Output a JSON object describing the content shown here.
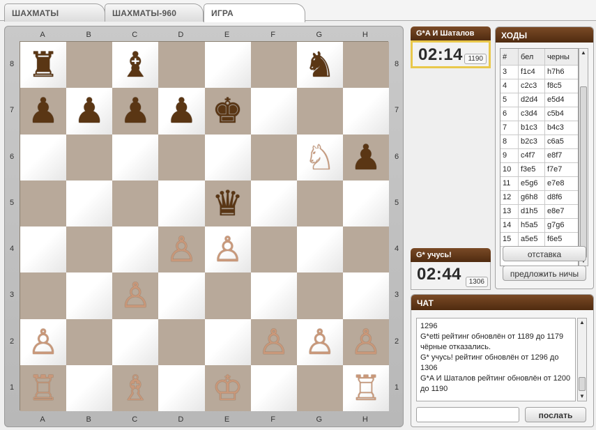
{
  "tabs": [
    {
      "label": "ШАХМАТЫ",
      "active": false
    },
    {
      "label": "ШАХМАТЫ-960",
      "active": false
    },
    {
      "label": "ИГРА",
      "active": true
    }
  ],
  "board": {
    "files": [
      "A",
      "B",
      "C",
      "D",
      "E",
      "F",
      "G",
      "H"
    ],
    "ranks": [
      "8",
      "7",
      "6",
      "5",
      "4",
      "3",
      "2",
      "1"
    ],
    "squares": [
      [
        "♜",
        "",
        "♝",
        "",
        "",
        "",
        "♞",
        ""
      ],
      [
        "♟",
        "♟",
        "♟",
        "♟",
        "♚",
        "",
        "",
        ""
      ],
      [
        "",
        "",
        "",
        "",
        "",
        "",
        "♘",
        "♟"
      ],
      [
        "",
        "",
        "",
        "",
        "♛",
        "",
        "",
        ""
      ],
      [
        "",
        "",
        "",
        "♙",
        "♙",
        "",
        "",
        ""
      ],
      [
        "",
        "",
        "♙",
        "",
        "",
        "",
        "",
        ""
      ],
      [
        "♙",
        "",
        "",
        "",
        "",
        "♙",
        "♙",
        "♙"
      ],
      [
        "♖",
        "",
        "♗",
        "",
        "♔",
        "",
        "",
        "♖"
      ]
    ],
    "colors": [
      "b",
      "w"
    ],
    "pieceColors": [
      [
        "b",
        "",
        "b",
        "",
        "",
        "",
        "b",
        ""
      ],
      [
        "b",
        "b",
        "b",
        "b",
        "b",
        "",
        "",
        ""
      ],
      [
        "",
        "",
        "",
        "",
        "",
        "",
        "w",
        "b"
      ],
      [
        "",
        "",
        "",
        "",
        "b",
        "",
        "",
        ""
      ],
      [
        "",
        "",
        "",
        "w",
        "w",
        "",
        "",
        ""
      ],
      [
        "",
        "",
        "w",
        "",
        "",
        "",
        "",
        ""
      ],
      [
        "w",
        "",
        "",
        "",
        "",
        "w",
        "w",
        "w"
      ],
      [
        "w",
        "",
        "w",
        "",
        "w",
        "",
        "",
        "w"
      ]
    ]
  },
  "clocks": {
    "top": {
      "player": "G*A И Шаталов",
      "time": "02:14",
      "rating": "1190"
    },
    "bottom": {
      "player": "G* учусь!",
      "time": "02:44",
      "rating": "1306"
    }
  },
  "moves": {
    "title": "ХОДЫ",
    "columns": [
      "#",
      "бел",
      "черны"
    ],
    "rows": [
      [
        "3",
        "f1c4",
        "h7h6"
      ],
      [
        "4",
        "c2c3",
        "f8c5"
      ],
      [
        "5",
        "d2d4",
        "e5d4"
      ],
      [
        "6",
        "c3d4",
        "c5b4"
      ],
      [
        "7",
        "b1c3",
        "b4c3"
      ],
      [
        "8",
        "b2c3",
        "c6a5"
      ],
      [
        "9",
        "c4f7",
        "e8f7"
      ],
      [
        "10",
        "f3e5",
        "f7e7"
      ],
      [
        "11",
        "e5g6",
        "e7e8"
      ],
      [
        "12",
        "g6h8",
        "d8f6"
      ],
      [
        "13",
        "d1h5",
        "e8e7"
      ],
      [
        "14",
        "h5a5",
        "g7g6"
      ],
      [
        "15",
        "a5e5",
        "f6e5"
      ]
    ],
    "resign_label": "отставка",
    "draw_label": "предложить ничы"
  },
  "chat": {
    "title": "ЧАТ",
    "lines": [
      "1296",
      "G*etti рейтинг обновлён от 1189 до 1179",
      "чёрные отказались.",
      "G* учусь! рейтинг обновлён от 1296 до 1306",
      "G*A И Шаталов рейтинг обновлён от 1200 до 1190"
    ],
    "input_value": "",
    "send_label": "послать"
  }
}
